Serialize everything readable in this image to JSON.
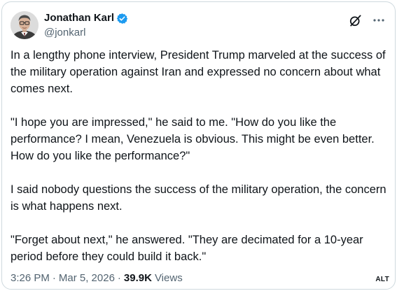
{
  "author": {
    "display_name": "Jonathan Karl",
    "handle": "@jonkarl",
    "verified": true,
    "verified_color": "#1d9bf0"
  },
  "header_icons": {
    "grok": "grok-icon",
    "more": "more-icon"
  },
  "tweet": {
    "paragraphs": [
      "In a lengthy phone interview, President Trump marveled at the success of the military operation against Iran and expressed no concern about what comes next.",
      "\"I hope you are impressed,\" he said to me. \"How do you like the performance? I mean, Venezuela is obvious. This might be even better. How do you like the performance?\"",
      "I said nobody questions the success of the military operation, the concern is what happens next.",
      "\"Forget about next,\" he answered. \"They are decimated for a 10-year period before they could build it back.\""
    ]
  },
  "meta": {
    "time": "3:26 PM",
    "separator": "·",
    "date": "Mar 5, 2026",
    "views_count": "39.9K",
    "views_label": "Views"
  },
  "alt_badge": "ALT",
  "colors": {
    "text_primary": "#0f1419",
    "text_secondary": "#536471",
    "border": "#cfd9de"
  }
}
